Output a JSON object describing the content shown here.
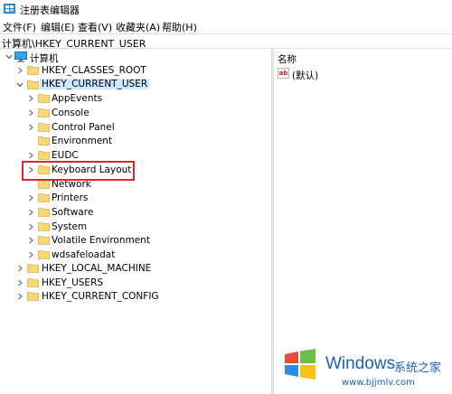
{
  "window": {
    "title": "注册表编辑器"
  },
  "menu": {
    "items": [
      {
        "label": "文件(F)"
      },
      {
        "label": "编辑(E)"
      },
      {
        "label": "查看(V)"
      },
      {
        "label": "收藏夹(A)"
      },
      {
        "label": "帮助(H)"
      }
    ]
  },
  "address": {
    "path": "计算机\\HKEY_CURRENT_USER"
  },
  "tree": {
    "root": "计算机",
    "hives": [
      {
        "label": "HKEY_CLASSES_ROOT"
      },
      {
        "label": "HKEY_CURRENT_USER"
      },
      {
        "label": "HKEY_LOCAL_MACHINE"
      },
      {
        "label": "HKEY_USERS"
      },
      {
        "label": "HKEY_CURRENT_CONFIG"
      }
    ],
    "current_user_children": [
      {
        "label": "AppEvents"
      },
      {
        "label": "Console"
      },
      {
        "label": "Control Panel"
      },
      {
        "label": "Environment"
      },
      {
        "label": "EUDC"
      },
      {
        "label": "Keyboard Layout"
      },
      {
        "label": "Network"
      },
      {
        "label": "Printers"
      },
      {
        "label": "Software"
      },
      {
        "label": "System"
      },
      {
        "label": "Volatile Environment"
      },
      {
        "label": "wdsafeloadat"
      }
    ]
  },
  "values_pane": {
    "column_name": "名称",
    "rows": [
      {
        "name": "(默认)",
        "icon": "string-value-icon"
      }
    ]
  },
  "watermark": {
    "brand": "Windows",
    "sub": "系统之家",
    "url": "www.bjjmlv.com"
  },
  "colors": {
    "highlight": "#e0252c",
    "selection": "#cce8ff",
    "folder": "#f8d775",
    "watermark": "#1b5fb5"
  }
}
